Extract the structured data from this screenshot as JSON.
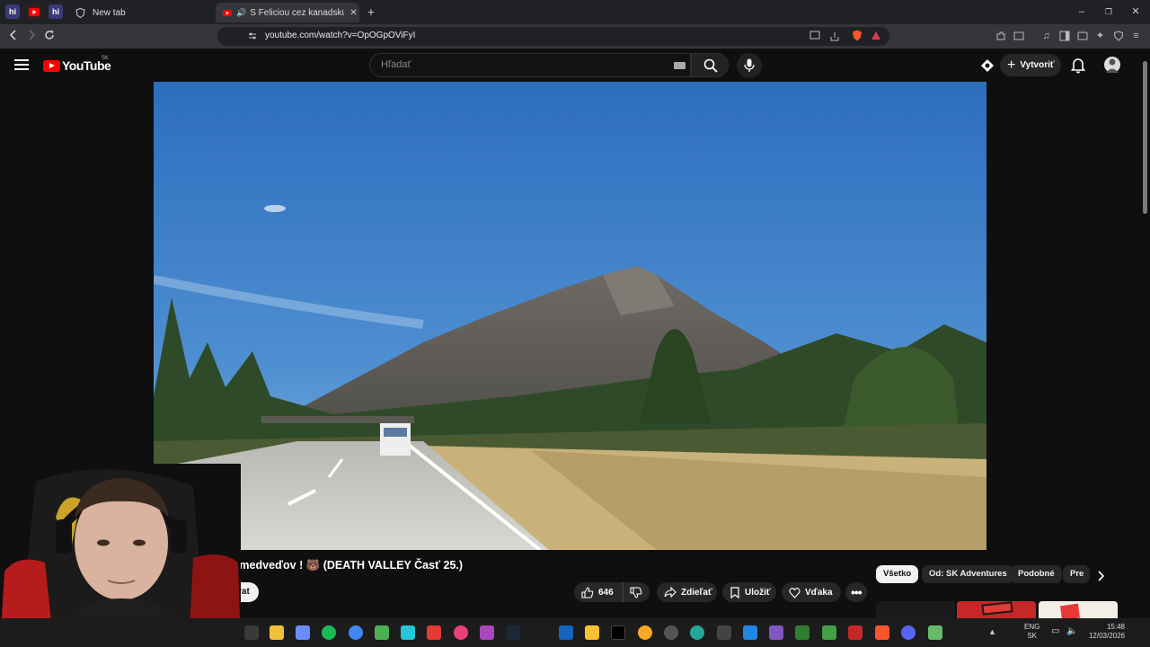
{
  "browser": {
    "pinned_tabs": [
      "hi",
      "yt",
      "hi"
    ],
    "tabs": [
      {
        "label": "New tab"
      },
      {
        "label": "S Feliciou cez kanadskú divoč"
      }
    ],
    "url": "youtube.com/watch?v=OpOGpOViFyI"
  },
  "youtube": {
    "logo_text": "YouTube",
    "country_code": "SK",
    "search_placeholder": "Hľadať",
    "create_label": "Vytvoriť"
  },
  "video": {
    "title": "ý medveďov ! 🐻 (DEATH VALLEY Časť 25.)",
    "subscribe_label": "rat",
    "likes": "646",
    "share_label": "Zdieľať",
    "save_label": "Uložiť",
    "thanks_label": "Vďaka"
  },
  "chips": [
    "Všetko",
    "Od: SK Adventures",
    "Podobné",
    "Pre"
  ],
  "taskbar": {
    "lang": "ENG",
    "layout": "SK",
    "time": "15:48",
    "date": "12/03/2026"
  },
  "colors": {
    "yt_red": "#ff0000",
    "background": "#0f0f0f",
    "chip_bg": "#272727"
  }
}
